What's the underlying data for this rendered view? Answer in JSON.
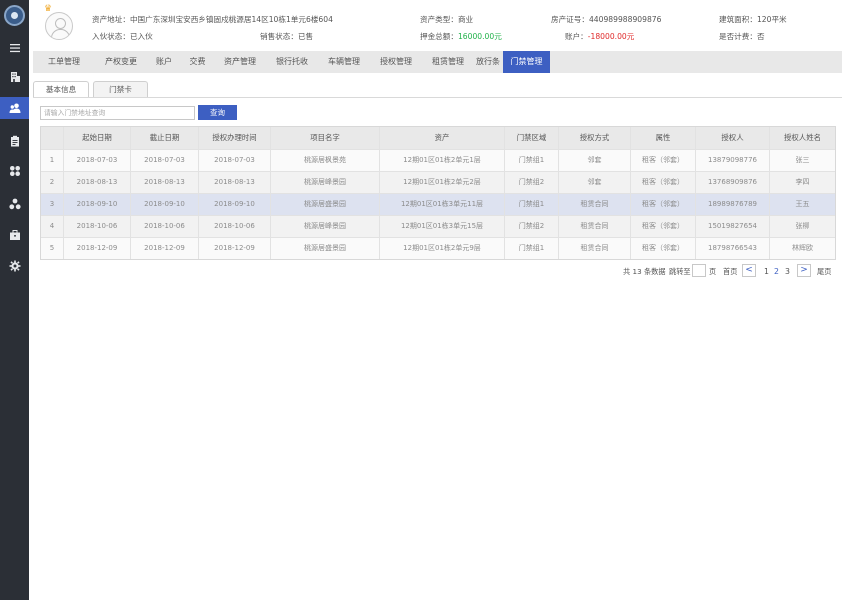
{
  "sidebar": {
    "icons": [
      "menu-icon",
      "building-icon",
      "users-icon",
      "clipboard-icon",
      "apps-icon",
      "network-icon",
      "briefcase-icon",
      "gear-icon"
    ],
    "active": "users-icon"
  },
  "header": {
    "address_label": "资产地址：",
    "address_value": "中国广东深圳宝安西乡镇固戍桃源居14区10栋1单元6楼604",
    "type_label": "资产类型：",
    "type_value": "商业",
    "cert_label": "房产证号：",
    "cert_value": "440989988909876",
    "area_label": "建筑面积：",
    "area_value": "120平米",
    "join_label": "入伙状态：",
    "join_value": "已入伙",
    "sale_label": "销售状态：",
    "sale_value": "已售",
    "deposit_label": "押金总额：",
    "deposit_value": "16000.00元",
    "account_label": "账户：",
    "account_value": "-18000.00元",
    "billing_label": "是否计费：",
    "billing_value": "否"
  },
  "tabs": [
    "工单管理",
    "产权变更",
    "账户",
    "交费",
    "资产管理",
    "银行托收",
    "车辆管理",
    "授权管理",
    "租赁管理",
    "放行条",
    "门禁管理"
  ],
  "active_tab": "门禁管理",
  "subtabs": [
    "基本信息",
    "门禁卡"
  ],
  "search": {
    "placeholder": "请输入门禁地址查询",
    "button": "查询"
  },
  "table": {
    "columns": [
      "",
      "起始日期",
      "截止日期",
      "授权办理时间",
      "项目名字",
      "资产",
      "门禁区域",
      "授权方式",
      "属性",
      "授权人",
      "授权人姓名"
    ],
    "rows": [
      [
        "1",
        "2018-07-03",
        "2018-07-03",
        "2018-07-03",
        "桃源居枫景苑",
        "12期01区01栋2单元1层",
        "门禁组1",
        "邻套",
        "租客（邻套）",
        "13879098776",
        "张三"
      ],
      [
        "2",
        "2018-08-13",
        "2018-08-13",
        "2018-08-13",
        "桃源居峰景园",
        "12期01区01栋2单元2层",
        "门禁组2",
        "邻套",
        "租客（邻套）",
        "13768909876",
        "李四"
      ],
      [
        "3",
        "2018-09-10",
        "2018-09-10",
        "2018-09-10",
        "桃源居盛景园",
        "12期01区01栋3单元11层",
        "门禁组1",
        "租赁合同",
        "租客（邻套）",
        "18989876789",
        "王五"
      ],
      [
        "4",
        "2018-10-06",
        "2018-10-06",
        "2018-10-06",
        "桃源居峰景园",
        "12期01区01栋3单元15层",
        "门禁组2",
        "租赁合同",
        "租客（邻套）",
        "15019827654",
        "张柳"
      ],
      [
        "5",
        "2018-12-09",
        "2018-12-09",
        "2018-12-09",
        "桃源居盛景园",
        "12期01区01栋2单元9层",
        "门禁组1",
        "租赁合同",
        "租客（邻套）",
        "18798766543",
        "林辉欧"
      ]
    ]
  },
  "pagination": {
    "total_prefix": "共",
    "total_count": "13",
    "total_suffix": "条数据",
    "jump_label": "跳转至",
    "page_suffix": "页",
    "first": "首页",
    "prev": "<",
    "pages": [
      "1",
      "2",
      "3"
    ],
    "current": "2",
    "next": ">",
    "last": "尾页"
  }
}
